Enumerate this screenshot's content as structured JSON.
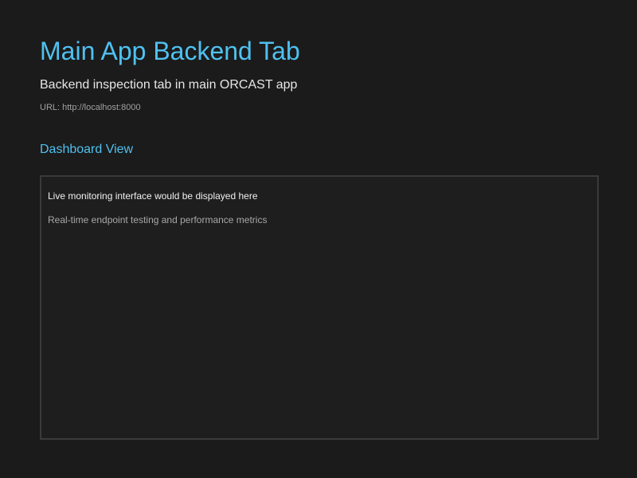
{
  "header": {
    "title": "Main App Backend Tab",
    "subtitle": "Backend inspection tab in main ORCAST app",
    "url_text": "URL: http://localhost:8000"
  },
  "dashboard": {
    "heading": "Dashboard View",
    "panel": {
      "primary_text": "Live monitoring interface would be displayed here",
      "secondary_text": "Real-time endpoint testing and performance metrics"
    }
  },
  "colors": {
    "background": "#1b1b1b",
    "accent": "#4fc1f0",
    "text_primary": "#e6e6e6",
    "text_muted": "#a0a0a0",
    "panel_border": "#3a3a3a"
  }
}
